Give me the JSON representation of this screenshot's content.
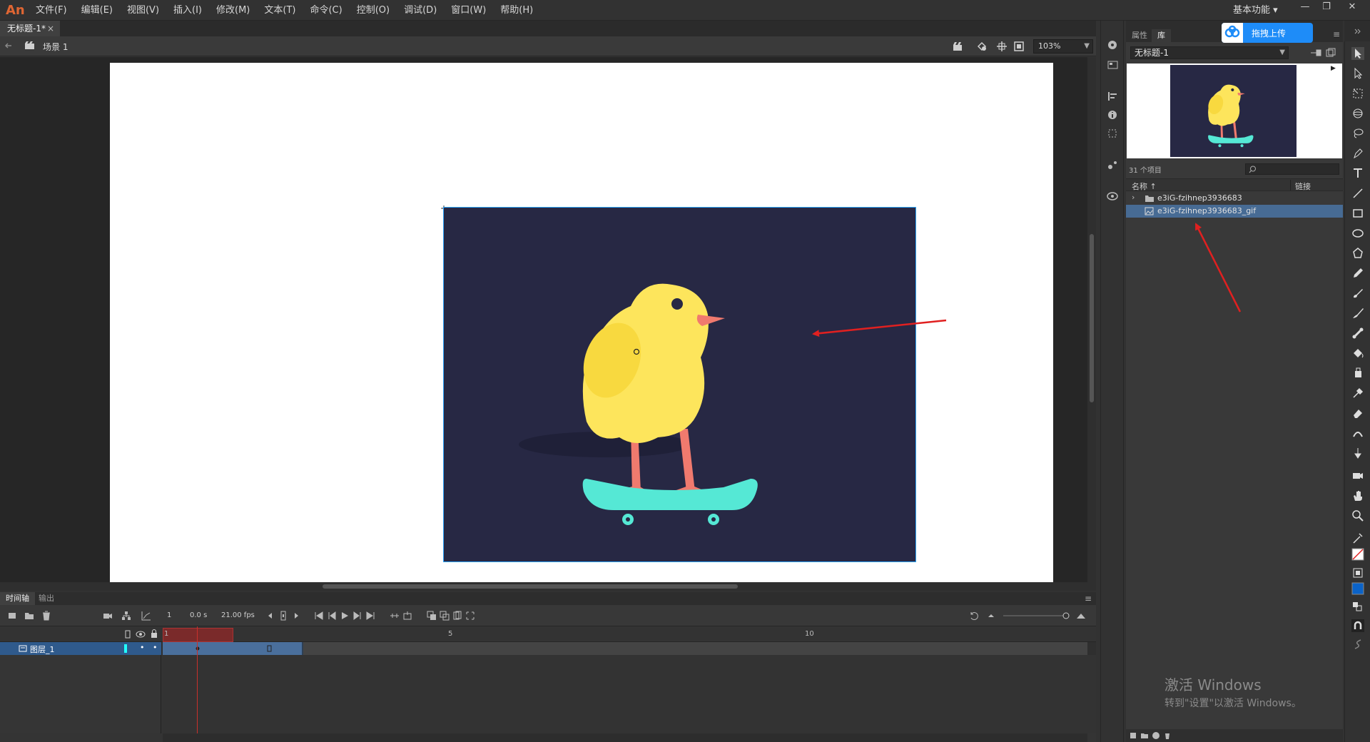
{
  "app": {
    "logo": "An"
  },
  "menu": [
    "文件(F)",
    "编辑(E)",
    "视图(V)",
    "插入(I)",
    "修改(M)",
    "文本(T)",
    "命令(C)",
    "控制(O)",
    "调试(D)",
    "窗口(W)",
    "帮助(H)"
  ],
  "workspace": "基本功能",
  "window_controls": [
    "—",
    "❐",
    "✕"
  ],
  "document_tab": {
    "title": "无标题-1*",
    "close": "×"
  },
  "scene": {
    "label": "场景 1",
    "zoom": "103%"
  },
  "timeline": {
    "tabs": [
      "时间轴",
      "输出"
    ],
    "frame": "1",
    "time": "0.0 s",
    "fps": "21.00 fps",
    "ruler": [
      "1",
      "5",
      "10"
    ],
    "layer_name": "图层_1"
  },
  "library": {
    "tabs": [
      "属性",
      "库"
    ],
    "upload_label": "拖拽上传",
    "document": "无标题-1",
    "item_count": "31 个项目",
    "columns": [
      "名称 ↑",
      "链接"
    ],
    "items": [
      {
        "name": "e3iG-fzihnep3936683",
        "type": "folder",
        "selected": false
      },
      {
        "name": "e3iG-fzihnep3936683_gif",
        "type": "bitmap",
        "selected": true
      }
    ]
  },
  "watermark": {
    "line1": "激活 Windows",
    "line2": "转到\"设置\"以激活 Windows。"
  },
  "colors": {
    "stage_bg": "#272844",
    "chick_body": "#fde55c",
    "skateboard": "#55e8d5",
    "legs": "#f07a6e",
    "selection": "#2fa7ff",
    "arrow": "#e02020",
    "fill_swatch": "#0b63c8"
  }
}
